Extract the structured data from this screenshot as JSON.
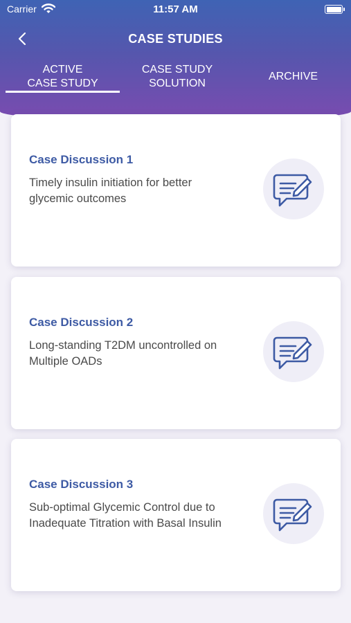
{
  "status_bar": {
    "carrier": "Carrier",
    "time": "11:57 AM"
  },
  "header": {
    "title": "CASE STUDIES"
  },
  "tabs": {
    "active": {
      "line1": "ACTIVE",
      "line2": "CASE STUDY"
    },
    "solution": {
      "line1": "CASE STUDY",
      "line2": "SOLUTION"
    },
    "archive": {
      "label": "ARCHIVE"
    }
  },
  "cases": [
    {
      "title": "Case Discussion 1",
      "desc_line1": "Timely insulin initiation for better",
      "desc_line2": "glycemic outcomes",
      "icon": "note-edit-icon"
    },
    {
      "title": "Case Discussion 2",
      "desc_line1": "Long-standing T2DM uncontrolled on",
      "desc_line2": "Multiple OADs",
      "icon": "note-edit-icon"
    },
    {
      "title": "Case Discussion 3",
      "desc_line1": "Sub-optimal Glycemic Control due to",
      "desc_line2": "Inadequate Titration with Basal Insulin",
      "icon": "note-edit-icon"
    }
  ],
  "colors": {
    "header_top": "#3f63b4",
    "header_bottom": "#7b4bb0",
    "card_title": "#3d5aa4",
    "icon_stroke": "#3d5aa4"
  }
}
